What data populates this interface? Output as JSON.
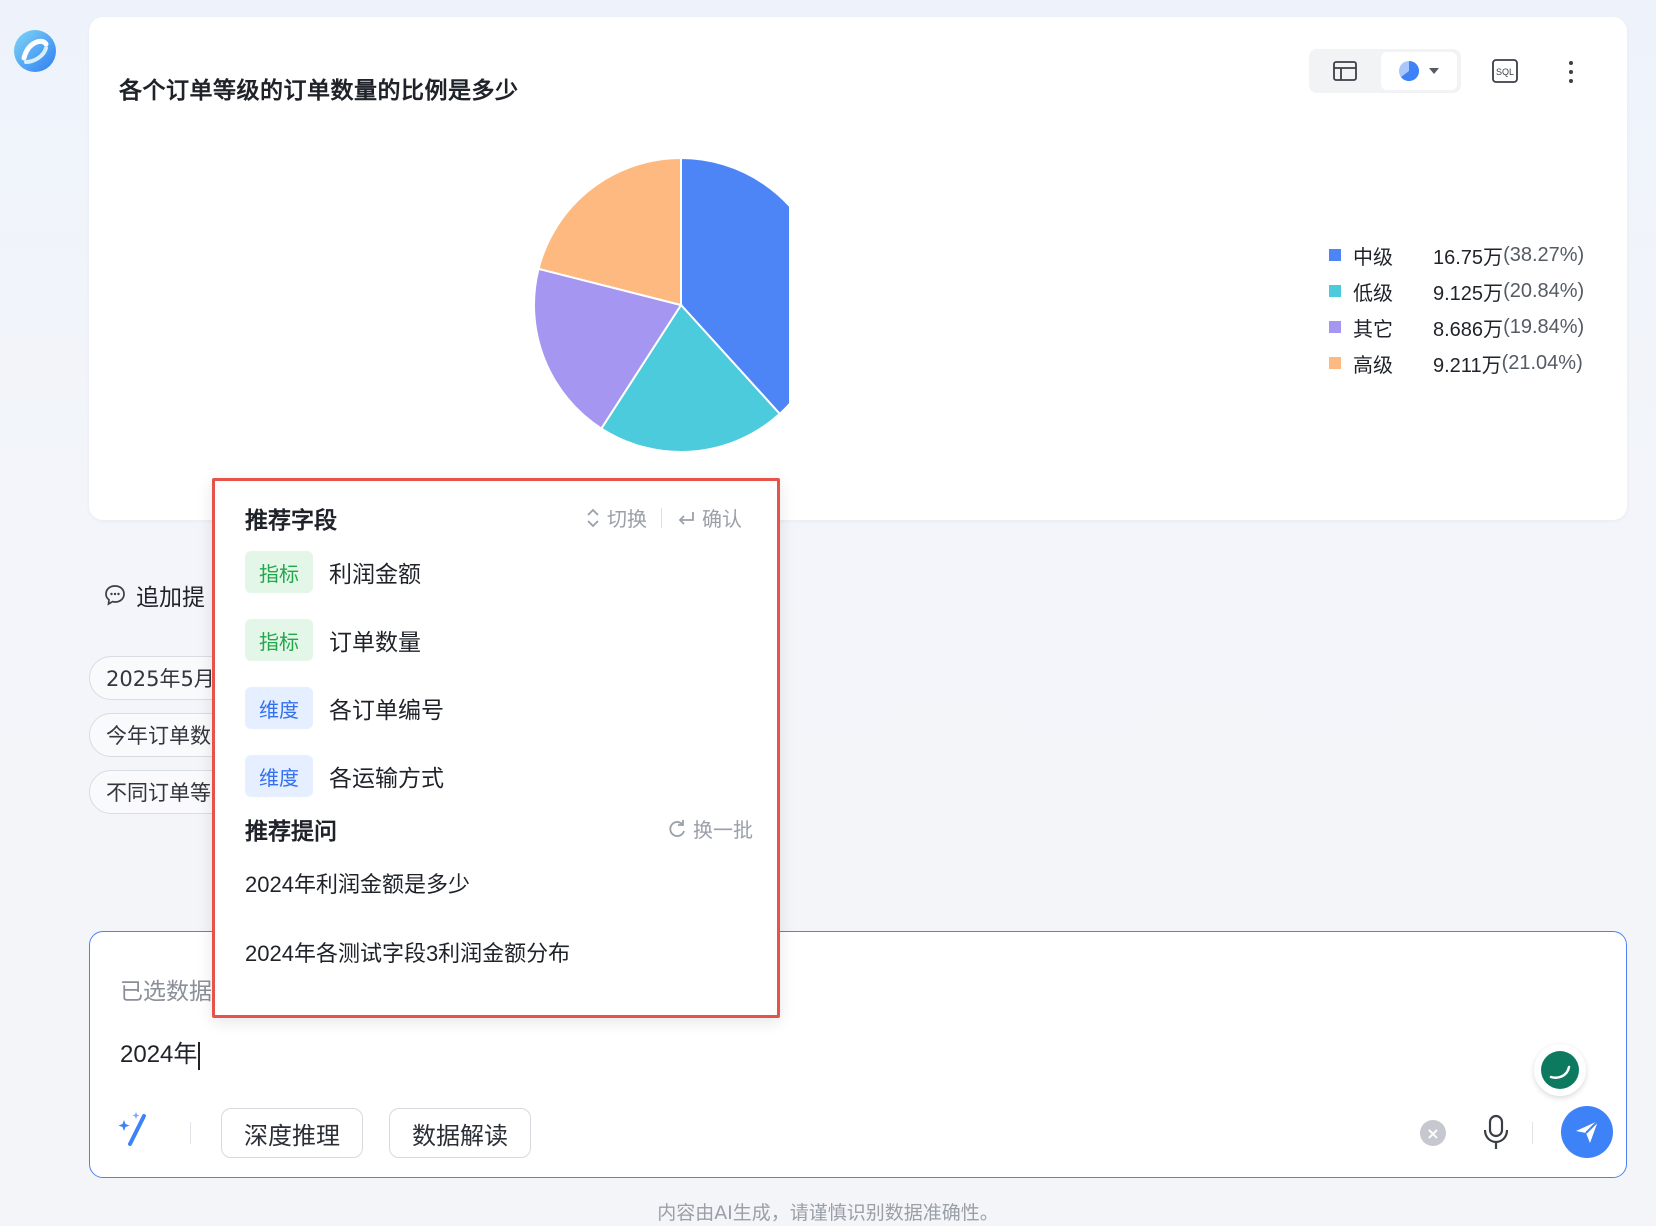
{
  "chart_card": {
    "title": "各个订单等级的订单数量的比例是多少",
    "toolbar": {
      "table_icon": "table-icon",
      "chart_type_icon": "pie-chart-icon",
      "sql_label": "SQL",
      "more_icon": "more-vertical-icon"
    }
  },
  "chart_data": {
    "type": "pie",
    "title": "各个订单等级的订单数量的比例是多少",
    "slices": [
      {
        "label": "中级",
        "value_text": "16.75万",
        "pct_text": "(38.27%)",
        "percent": 38.27,
        "color": "#4d85f7"
      },
      {
        "label": "低级",
        "value_text": "9.125万",
        "pct_text": "(20.84%)",
        "percent": 20.84,
        "color": "#4ccbdd"
      },
      {
        "label": "其它",
        "value_text": "8.686万",
        "pct_text": "(19.84%)",
        "percent": 19.84,
        "color": "#a597f1"
      },
      {
        "label": "高级",
        "value_text": "9.211万",
        "pct_text": "(21.04%)",
        "percent": 21.04,
        "color": "#fdb97f"
      }
    ],
    "legend": "right"
  },
  "followup": {
    "label": "追加提",
    "chips": [
      "2025年5月",
      "今年订单数",
      "不同订单等"
    ]
  },
  "popup": {
    "fields_title": "推荐字段",
    "switch_hint": "切换",
    "confirm_hint": "确认",
    "fields": [
      {
        "tag": "指标",
        "kind": "metric",
        "name": "利润金额"
      },
      {
        "tag": "指标",
        "kind": "metric",
        "name": "订单数量"
      },
      {
        "tag": "维度",
        "kind": "dimension",
        "name": "各订单编号"
      },
      {
        "tag": "维度",
        "kind": "dimension",
        "name": "各运输方式"
      }
    ],
    "questions_title": "推荐提问",
    "refresh_label": "换一批",
    "questions": [
      "2024年利润金额是多少",
      "2024年各测试字段3利润金额分布"
    ]
  },
  "input": {
    "selected_data_label": "已选数据",
    "query": "2024年",
    "buttons": {
      "deep_reasoning": "深度推理",
      "data_interpretation": "数据解读"
    }
  },
  "disclaimer": "内容由AI生成，请谨慎识别数据准确性。",
  "colors": {
    "accent": "#3e82f7",
    "popup_border": "#e5534b"
  }
}
